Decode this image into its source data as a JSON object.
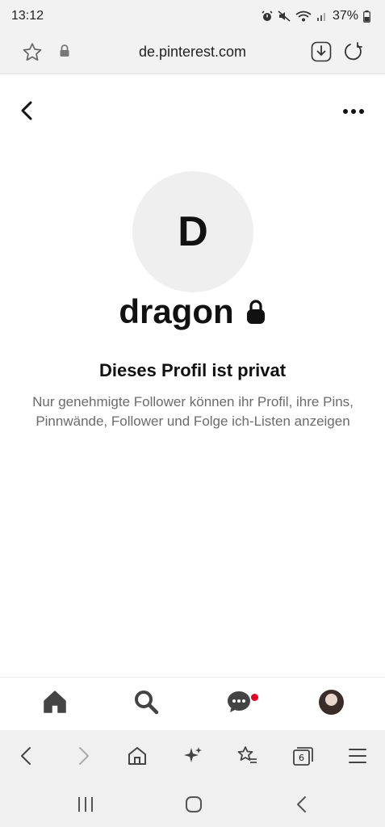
{
  "status_bar": {
    "time": "13:12",
    "battery": "37%"
  },
  "browser": {
    "url": "de.pinterest.com",
    "tab_count": "6"
  },
  "profile": {
    "initial": "D",
    "name": "dragon",
    "private_title": "Dieses Profil ist privat",
    "private_description": "Nur genehmigte Follower können ihr Profil, ihre Pins, Pinnwände, Follower und Folge ich-Listen anzeigen"
  },
  "colors": {
    "notification_dot": "#e60023",
    "avatar_bg": "#efefef"
  },
  "icons": {
    "header": [
      "back-chevron-icon",
      "more-options-icon"
    ],
    "bottom_nav": [
      "home-icon",
      "search-icon",
      "messages-icon",
      "profile-avatar"
    ],
    "browser_toolbar": [
      "back-icon",
      "forward-icon",
      "home-icon",
      "sparkle-icon",
      "bookmarks-icon",
      "tabs-icon",
      "menu-icon"
    ],
    "system_nav": [
      "recents-icon",
      "home-icon",
      "back-icon"
    ]
  }
}
